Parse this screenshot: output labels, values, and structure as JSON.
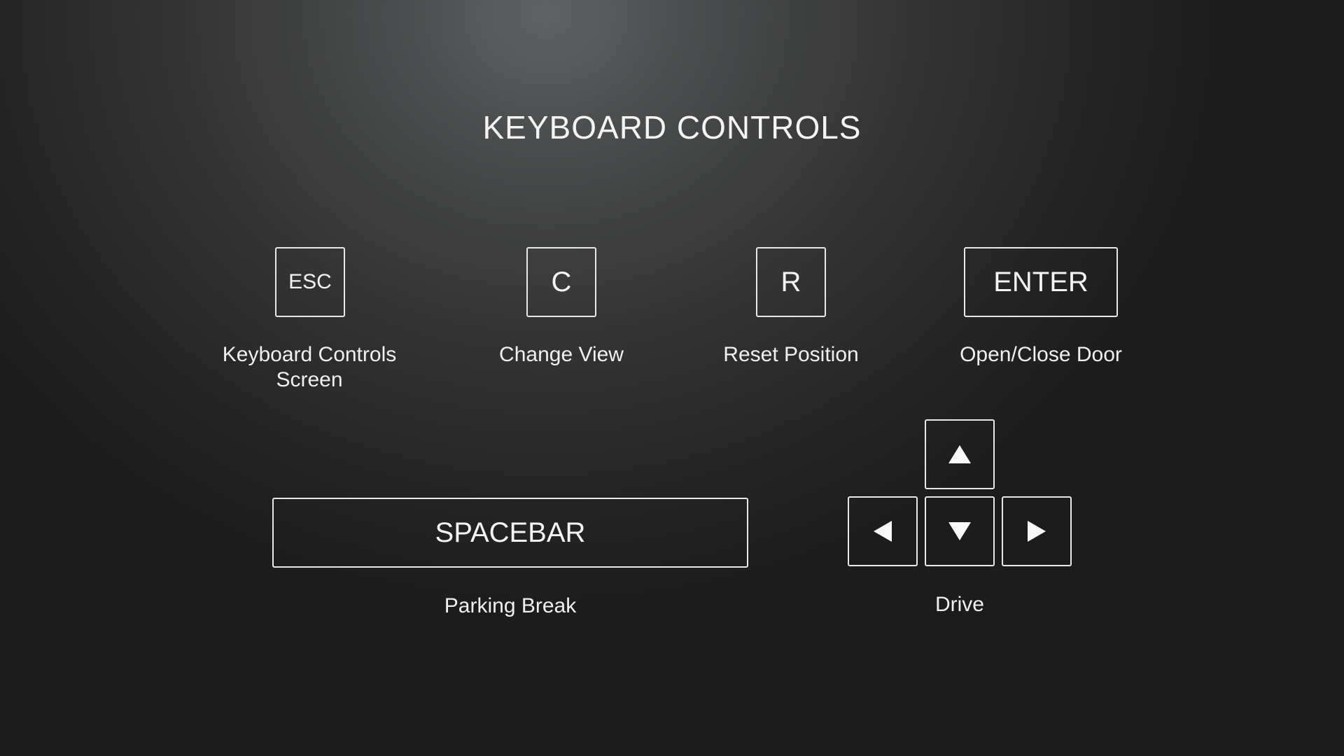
{
  "title": "KEYBOARD CONTROLS",
  "controls": {
    "esc": {
      "key": "ESC",
      "action": "Keyboard Controls Screen"
    },
    "c": {
      "key": "C",
      "action": "Change View"
    },
    "r": {
      "key": "R",
      "action": "Reset Position"
    },
    "enter": {
      "key": "ENTER",
      "action": "Open/Close Door"
    },
    "spacebar": {
      "key": "SPACEBAR",
      "action": "Parking Break"
    },
    "drive": {
      "action": "Drive",
      "keys": [
        "arrow-up-icon",
        "arrow-left-icon",
        "arrow-down-icon",
        "arrow-right-icon"
      ]
    }
  },
  "colors": {
    "text": "#f4f4f4",
    "key_border": "#e8e8e8",
    "background_light": "#5f6263",
    "background_dark": "#1c1c1c"
  }
}
